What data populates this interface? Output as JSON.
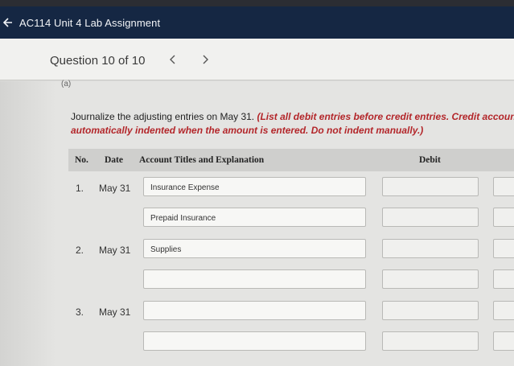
{
  "header": {
    "title": "AC114 Unit 4 Lab Assignment",
    "back_icon": "arrow-left-icon"
  },
  "question": {
    "label": "Question 10 of 10",
    "prev_icon": "chevron-left-icon",
    "next_icon": "chevron-right-icon"
  },
  "part_label": "(a)",
  "instructions": {
    "plain": "Journalize the adjusting entries on May 31. ",
    "emphasis_line1": "(List all debit entries before credit entries. Credit account titl",
    "emphasis_line2": "automatically indented when the amount is entered. Do not indent manually.)"
  },
  "table": {
    "headers": {
      "no": "No.",
      "date": "Date",
      "account": "Account Titles and Explanation",
      "debit": "Debit"
    },
    "rows": [
      {
        "no": "1.",
        "date": "May 31",
        "account": "Insurance Expense",
        "debit": ""
      },
      {
        "no": "",
        "date": "",
        "account": "Prepaid Insurance",
        "debit": ""
      },
      {
        "no": "2.",
        "date": "May 31",
        "account": "Supplies",
        "debit": ""
      },
      {
        "no": "",
        "date": "",
        "account": "",
        "debit": ""
      },
      {
        "no": "3.",
        "date": "May 31",
        "account": "",
        "debit": ""
      },
      {
        "no": "",
        "date": "",
        "account": "",
        "debit": ""
      }
    ]
  },
  "colors": {
    "header_bg": "#152743",
    "emphasis": "#b3262a"
  }
}
